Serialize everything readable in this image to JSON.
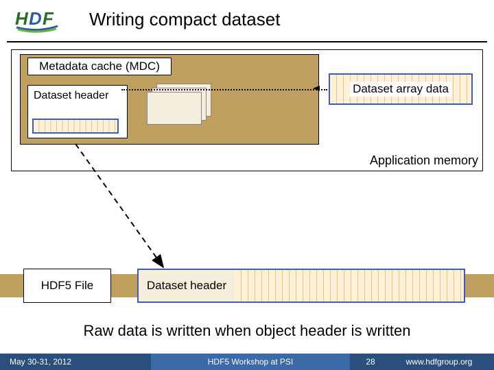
{
  "title": "Writing compact dataset",
  "mdc_label": "Metadata cache (MDC)",
  "dataset_header_label": "Dataset header",
  "array_data_label": "Dataset array data",
  "app_memory_label": "Application memory",
  "hdf5_file_label": "HDF5 File",
  "file_header_label": "Dataset header",
  "caption": "Raw data is written when object header is written",
  "footer": {
    "date": "May 30-31, 2012",
    "workshop": "HDF5 Workshop at PSI",
    "page": "28",
    "url": "www.hdfgroup.org"
  }
}
